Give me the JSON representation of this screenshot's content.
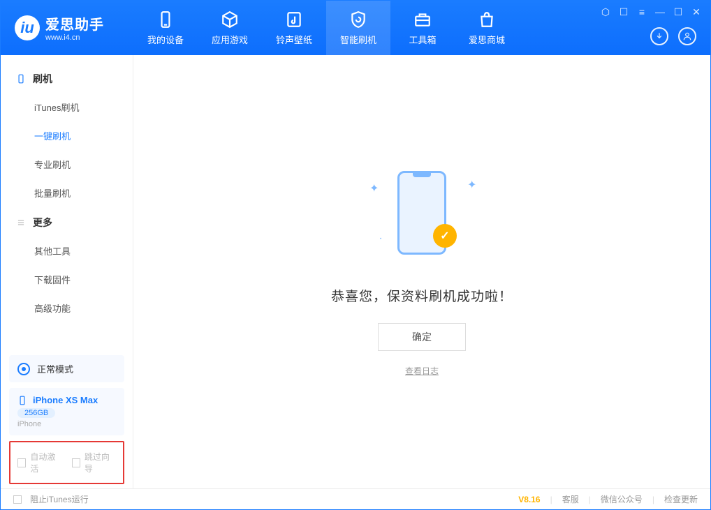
{
  "app": {
    "title": "爱思助手",
    "subtitle": "www.i4.cn"
  },
  "tabs": [
    {
      "label": "我的设备"
    },
    {
      "label": "应用游戏"
    },
    {
      "label": "铃声壁纸"
    },
    {
      "label": "智能刷机"
    },
    {
      "label": "工具箱"
    },
    {
      "label": "爱思商城"
    }
  ],
  "sidebar": {
    "group1_title": "刷机",
    "group1_items": [
      {
        "label": "iTunes刷机"
      },
      {
        "label": "一键刷机"
      },
      {
        "label": "专业刷机"
      },
      {
        "label": "批量刷机"
      }
    ],
    "group2_title": "更多",
    "group2_items": [
      {
        "label": "其他工具"
      },
      {
        "label": "下载固件"
      },
      {
        "label": "高级功能"
      }
    ]
  },
  "mode": {
    "label": "正常模式"
  },
  "device": {
    "name": "iPhone XS Max",
    "capacity": "256GB",
    "type": "iPhone"
  },
  "options": {
    "auto_activate": "自动激活",
    "skip_guide": "跳过向导"
  },
  "content": {
    "success_text": "恭喜您，保资料刷机成功啦！",
    "ok": "确定",
    "view_log": "查看日志"
  },
  "footer": {
    "block_itunes": "阻止iTunes运行",
    "version": "V8.16",
    "links": [
      "客服",
      "微信公众号",
      "检查更新"
    ]
  }
}
